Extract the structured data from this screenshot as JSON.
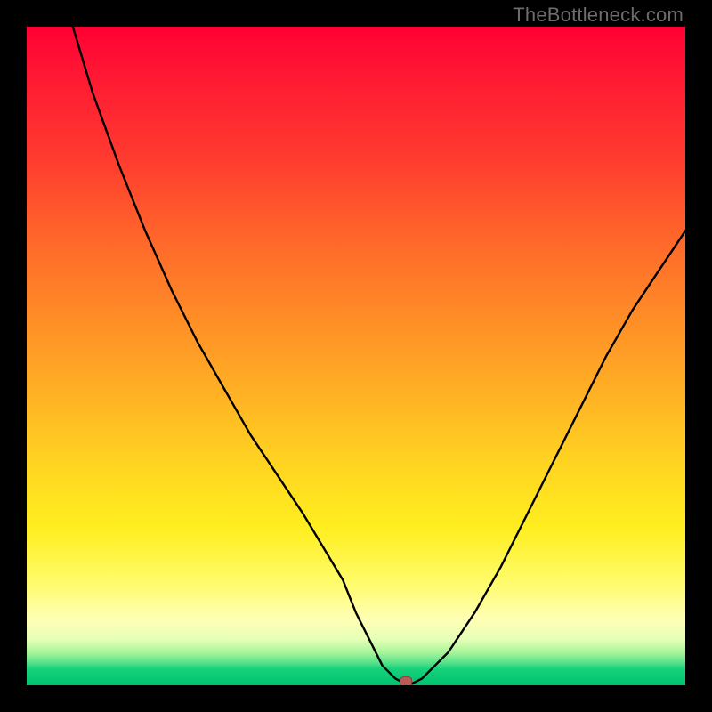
{
  "watermark": "TheBottleneck.com",
  "chart_data": {
    "type": "line",
    "title": "",
    "xlabel": "",
    "ylabel": "",
    "xlim": [
      0,
      100
    ],
    "ylim": [
      0,
      100
    ],
    "grid": false,
    "series": [
      {
        "name": "curve",
        "x": [
          7,
          10,
          14,
          18,
          22,
          26,
          30,
          34,
          38,
          42,
          45,
          48,
          50,
          52,
          54,
          56,
          58,
          60,
          64,
          68,
          72,
          76,
          80,
          84,
          88,
          92,
          96,
          100
        ],
        "y": [
          100,
          90,
          79,
          69,
          60,
          52,
          45,
          38,
          32,
          26,
          21,
          16,
          11,
          7,
          3,
          1,
          0,
          1,
          5,
          11,
          18,
          26,
          34,
          42,
          50,
          57,
          63,
          69
        ]
      }
    ],
    "marker": {
      "x": 57.5,
      "y": 0.5
    },
    "background_gradient": {
      "type": "vertical",
      "stops": [
        {
          "pos": 0.0,
          "color": "#ff0033"
        },
        {
          "pos": 0.5,
          "color": "#ffb020"
        },
        {
          "pos": 0.8,
          "color": "#fff040"
        },
        {
          "pos": 0.95,
          "color": "#d9ffb0"
        },
        {
          "pos": 1.0,
          "color": "#00c36f"
        }
      ]
    }
  }
}
